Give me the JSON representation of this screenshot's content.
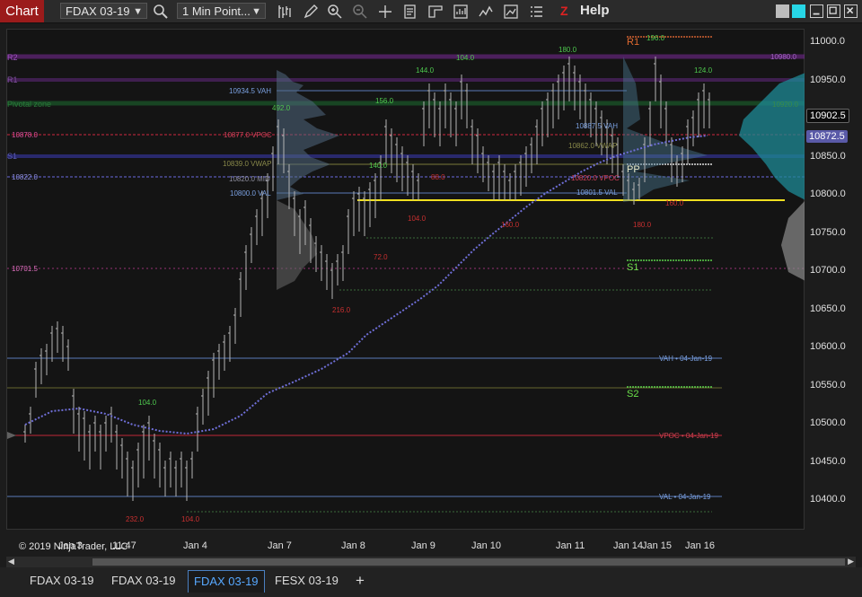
{
  "toolbar": {
    "chart_tab": "Chart",
    "instrument": "FDAX 03-19",
    "interval": "1 Min Point...",
    "help": "Help",
    "icons": [
      "search-icon",
      "bar-type-icon",
      "draw-icon",
      "zoom-in-icon",
      "zoom-out-icon",
      "crosshair-icon",
      "properties-icon",
      "data-box-icon",
      "strategy-icon",
      "indicator-icon",
      "template-icon",
      "list-icon",
      "zlogo-icon"
    ]
  },
  "y_axis": {
    "ticks": [
      "11000.0",
      "10950.0",
      "10900.0",
      "10850.0",
      "10800.0",
      "10750.0",
      "10700.0",
      "10650.0",
      "10600.0",
      "10550.0",
      "10500.0",
      "10450.0",
      "10400.0"
    ],
    "last_price": "10902.5",
    "marker_price": "10872.5"
  },
  "x_axis": {
    "labels": [
      "Jan 3",
      "11:47",
      "Jan 4",
      "Jan 7",
      "Jan 8",
      "Jan 9",
      "Jan 10",
      "Jan 11",
      "Jan 14",
      "Jan 15",
      "Jan 16"
    ]
  },
  "pivots": {
    "r1": "R1",
    "pp": "PP",
    "s1": "S1",
    "s2": "S2",
    "r2": "R2",
    "r1_faded": "R1",
    "pivotal_zone": "Pivotal zone",
    "s_faded": "S1"
  },
  "profile_labels": {
    "vah1": "10934.5 VAH",
    "vpoc1": "10877.0 VPOC",
    "vwap1": "10839.0 VWAP",
    "mid1": "10820.0 MID",
    "val1": "10800.0 VAL",
    "vah2": "10887.5 VAH",
    "vpoc2": "10820.0 VPOC",
    "vwap2": "10862.0 VWAP",
    "val2": "10801.5 VAL",
    "right_top": "10980.0",
    "right_mid": "10920.0",
    "left_a": "10878.0",
    "left_b": "10822.0",
    "left_c": "10701.5",
    "vah_old": "VAH • 04-Jan-19",
    "vpoc_old": "VPOC • 04-Jan-19",
    "val_old": "VAL • 04-Jan-19"
  },
  "swing_labels": {
    "highs": [
      "492.0",
      "156.0",
      "144.0",
      "104.0",
      "180.0",
      "196.0",
      "124.0",
      "140.0",
      "104.0"
    ],
    "lows": [
      "216.0",
      "72.0",
      "104.0",
      "88.0",
      "160.0",
      "160.0",
      "180.0",
      "232.0",
      "104.0"
    ]
  },
  "copyright": "© 2019 NinjaTrader, LLC",
  "tabs": [
    "FDAX 03-19",
    "FDAX 03-19",
    "FDAX 03-19",
    "FESX 03-19",
    "+"
  ],
  "active_tab_index": 2,
  "colors": {
    "background": "#141414",
    "bars": "#b4b4b4",
    "vwap": "#6f6fd8",
    "vpoc": "#d02840",
    "yellow_line": "#f0e020",
    "high_label": "#4ec84e",
    "low_label": "#c83030",
    "marker": "#5a5aa8"
  }
}
